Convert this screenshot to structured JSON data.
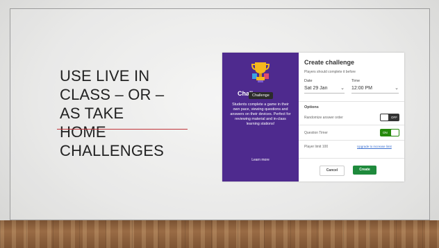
{
  "slide": {
    "heading_lines": [
      "USE LIVE IN",
      "CLASS – OR –",
      "AS TAKE",
      "HOME",
      "CHALLENGES"
    ]
  },
  "screenshot": {
    "left_panel": {
      "badge": "Challenge",
      "title": "Challenge",
      "description": "Students complete a game in their own pace, viewing questions and answers on their devices. Perfect for reviewing material and in-class learning stations!",
      "learn_more": "Learn more"
    },
    "form": {
      "title": "Create challenge",
      "subtitle": "Players should complete it before",
      "date_label": "Date",
      "date_value": "Sat 29 Jan",
      "time_label": "Time",
      "time_value": "12:00 PM",
      "options_label": "Options",
      "opt_randomize": "Randomize answer order",
      "opt_randomize_state": "OFF",
      "opt_timer": "Question Timer",
      "opt_timer_state": "ON",
      "opt_limit": "Player limit 100",
      "upgrade_link": "Upgrade to increase limit",
      "cancel": "Cancel",
      "create": "Create"
    },
    "colors": {
      "panel_purple": "#4e2a8e",
      "toggle_on": "#26890c",
      "toggle_off": "#333333",
      "create_green": "#1e8a3c"
    }
  }
}
